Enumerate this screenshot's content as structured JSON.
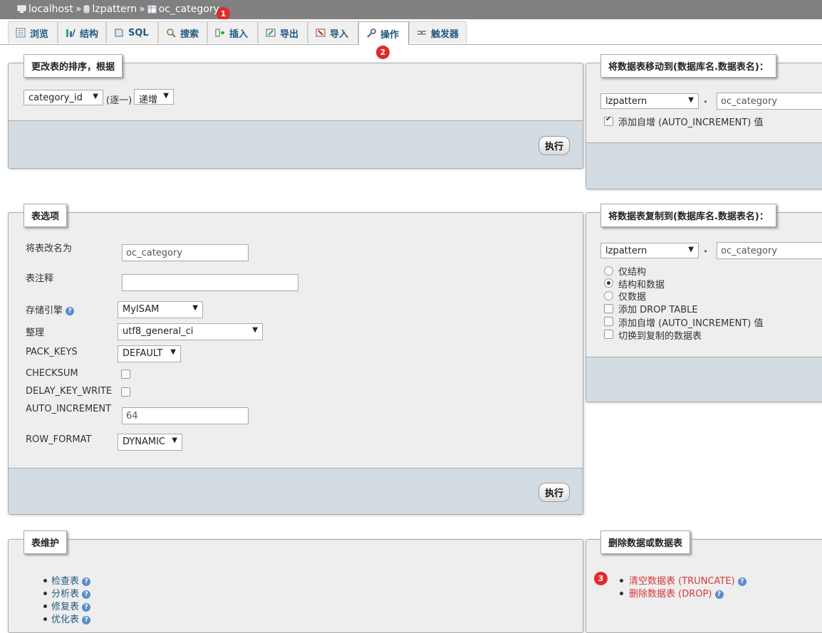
{
  "breadcrumb": {
    "server": "localhost",
    "database": "lzpattern",
    "table": "oc_category",
    "separator": "»"
  },
  "tabs": [
    {
      "label": "浏览",
      "icon": "browse-icon"
    },
    {
      "label": "结构",
      "icon": "structure-icon"
    },
    {
      "label": "SQL",
      "icon": "sql-icon"
    },
    {
      "label": "搜索",
      "icon": "search-icon"
    },
    {
      "label": "插入",
      "icon": "insert-icon"
    },
    {
      "label": "导出",
      "icon": "export-icon"
    },
    {
      "label": "导入",
      "icon": "import-icon"
    },
    {
      "label": "操作",
      "icon": "wrench-icon"
    },
    {
      "label": "触发器",
      "icon": "triggers-icon"
    }
  ],
  "badges": [
    "1",
    "2",
    "3"
  ],
  "order_panel": {
    "legend": "更改表的排序，根据",
    "column_value": "category_id",
    "singly_label": "(逐一)",
    "direction_value": "递增",
    "go_label": "执行"
  },
  "move_panel": {
    "legend": "将数据表移动到(数据库名.数据表名)：",
    "db_value": "lzpattern",
    "dot": ".",
    "table_value": "oc_category",
    "auto_increment_label": "添加自增 (AUTO_INCREMENT) 值"
  },
  "options_panel": {
    "legend": "表选项",
    "rename_label": "将表改名为",
    "rename_value": "oc_category",
    "comment_label": "表注释",
    "comment_value": "",
    "engine_label": "存储引擎",
    "engine_value": "MyISAM",
    "collation_label": "整理",
    "collation_value": "utf8_general_ci",
    "pack_keys_label": "PACK_KEYS",
    "pack_keys_value": "DEFAULT",
    "checksum_label": "CHECKSUM",
    "delay_key_write_label": "DELAY_KEY_WRITE",
    "auto_increment_label": "AUTO_INCREMENT",
    "auto_increment_value": "64",
    "row_format_label": "ROW_FORMAT",
    "row_format_value": "DYNAMIC",
    "go_label": "执行"
  },
  "copy_panel": {
    "legend": "将数据表复制到(数据库名.数据表名)：",
    "db_value": "lzpattern",
    "dot": ".",
    "table_value": "oc_category",
    "options": [
      "仅结构",
      "结构和数据",
      "仅数据"
    ],
    "checks": [
      "添加 DROP TABLE",
      "添加自增 (AUTO_INCREMENT) 值",
      "切换到复制的数据表"
    ]
  },
  "maintenance_panel": {
    "legend": "表维护",
    "items": [
      "检查表",
      "分析表",
      "修复表",
      "优化表"
    ]
  },
  "delete_panel": {
    "legend": "删除数据或数据表",
    "items": [
      "清空数据表 (TRUNCATE)",
      "删除数据表 (DROP)"
    ]
  },
  "colors": {
    "accent": "#235a81",
    "danger": "#d8383a",
    "badge": "#e02b2b",
    "footer": "#d3dce3"
  }
}
